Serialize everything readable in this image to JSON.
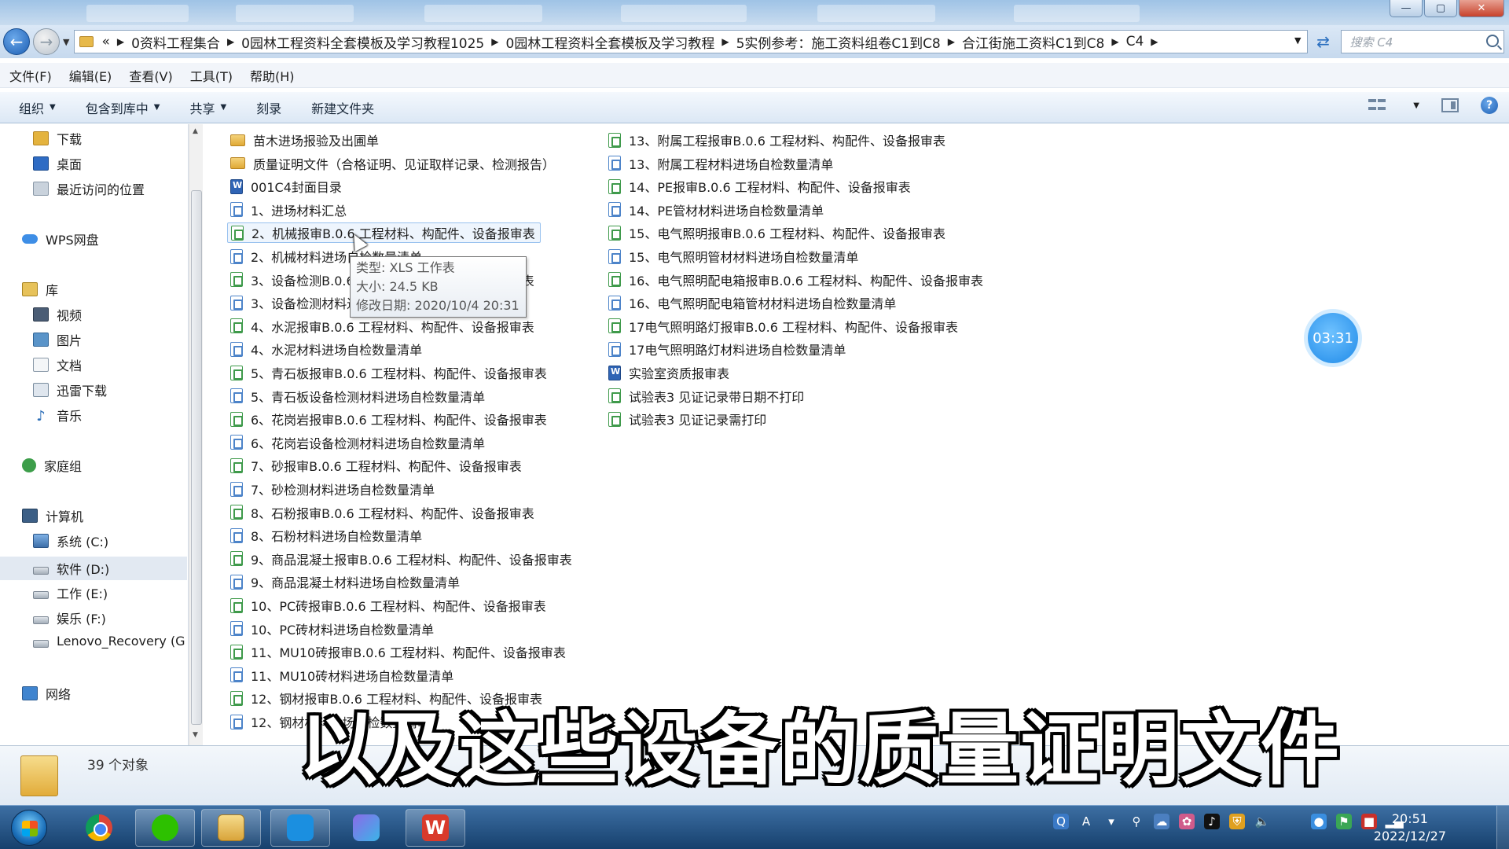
{
  "window_controls": {
    "minimize": "—",
    "maximize": "▢",
    "close": "✕"
  },
  "address": {
    "crumbs": [
      "«",
      "0资料工程集合",
      "0园林工程资料全套模板及学习教程1025",
      "0园林工程资料全套模板及学习教程",
      "5实例参考：施工资料组卷C1到C8",
      "合江街施工资料C1到C8",
      "C4"
    ],
    "search_placeholder": "搜索 C4"
  },
  "menu": [
    "文件(F)",
    "编辑(E)",
    "查看(V)",
    "工具(T)",
    "帮助(H)"
  ],
  "toolbar": {
    "organize": "组织",
    "include_library": "包含到库中",
    "share": "共享",
    "burn": "刻录",
    "new_folder": "新建文件夹"
  },
  "nav": {
    "downloads": "下载",
    "desktop": "桌面",
    "recent": "最近访问的位置",
    "wps_cloud": "WPS网盘",
    "libraries": "库",
    "videos": "视频",
    "pictures": "图片",
    "documents": "文档",
    "thunder": "迅雷下载",
    "music": "音乐",
    "homegroup": "家庭组",
    "computer": "计算机",
    "drive_c": "系统 (C:)",
    "drive_d": "软件 (D:)",
    "drive_e": "工作 (E:)",
    "drive_f": "娱乐 (F:)",
    "drive_g": "Lenovo_Recovery (G",
    "network": "网络"
  },
  "files_col1": [
    {
      "type": "folder",
      "name": "苗木进场报验及出圃单"
    },
    {
      "type": "folder",
      "name": "质量证明文件（合格证明、见证取样记录、检测报告）"
    },
    {
      "type": "doc",
      "name": "001C4封面目录"
    },
    {
      "type": "wps",
      "name": "1、进场材料汇总"
    },
    {
      "type": "xls",
      "name": "2、机械报审B.0.6 工程材料、构配件、设备报审表"
    },
    {
      "type": "wps",
      "name": "2、机械材料进场自检数量清单"
    },
    {
      "type": "xls",
      "name": "3、设备检测B.0.6 工程材料、构配件、设备报审表"
    },
    {
      "type": "wps",
      "name": "3、设备检测材料进场自检数量清单"
    },
    {
      "type": "xls",
      "name": "4、水泥报审B.0.6 工程材料、构配件、设备报审表"
    },
    {
      "type": "wps",
      "name": "4、水泥材料进场自检数量清单"
    },
    {
      "type": "xls",
      "name": "5、青石板报审B.0.6 工程材料、构配件、设备报审表"
    },
    {
      "type": "wps",
      "name": "5、青石板设备检测材料进场自检数量清单"
    },
    {
      "type": "xls",
      "name": "6、花岗岩报审B.0.6 工程材料、构配件、设备报审表"
    },
    {
      "type": "wps",
      "name": "6、花岗岩设备检测材料进场自检数量清单"
    },
    {
      "type": "xls",
      "name": "7、砂报审B.0.6 工程材料、构配件、设备报审表"
    },
    {
      "type": "wps",
      "name": "7、砂检测材料进场自检数量清单"
    },
    {
      "type": "xls",
      "name": "8、石粉报审B.0.6 工程材料、构配件、设备报审表"
    },
    {
      "type": "wps",
      "name": "8、石粉材料进场自检数量清单"
    },
    {
      "type": "xls",
      "name": "9、商品混凝土报审B.0.6 工程材料、构配件、设备报审表"
    },
    {
      "type": "wps",
      "name": "9、商品混凝土材料进场自检数量清单"
    },
    {
      "type": "xls",
      "name": "10、PC砖报审B.0.6 工程材料、构配件、设备报审表"
    },
    {
      "type": "wps",
      "name": "10、PC砖材料进场自检数量清单"
    },
    {
      "type": "xls",
      "name": "11、MU10砖报审B.0.6 工程材料、构配件、设备报审表"
    },
    {
      "type": "wps",
      "name": "11、MU10砖材料进场自检数量清单"
    },
    {
      "type": "xls",
      "name": "12、钢材报审B.0.6 工程材料、构配件、设备报审表"
    },
    {
      "type": "wps",
      "name": "12、钢材材料进场自检数量清单"
    }
  ],
  "files_col2": [
    {
      "type": "xls",
      "name": "13、附属工程报审B.0.6 工程材料、构配件、设备报审表"
    },
    {
      "type": "wps",
      "name": "13、附属工程材料进场自检数量清单"
    },
    {
      "type": "xls",
      "name": "14、PE报审B.0.6 工程材料、构配件、设备报审表"
    },
    {
      "type": "wps",
      "name": "14、PE管材材料进场自检数量清单"
    },
    {
      "type": "xls",
      "name": "15、电气照明报审B.0.6 工程材料、构配件、设备报审表"
    },
    {
      "type": "wps",
      "name": "15、电气照明管材材料进场自检数量清单"
    },
    {
      "type": "xls",
      "name": "16、电气照明配电箱报审B.0.6 工程材料、构配件、设备报审表"
    },
    {
      "type": "wps",
      "name": "16、电气照明配电箱管材材料进场自检数量清单"
    },
    {
      "type": "xls",
      "name": "17电气照明路灯报审B.0.6 工程材料、构配件、设备报审表"
    },
    {
      "type": "wps",
      "name": "17电气照明路灯材料进场自检数量清单"
    },
    {
      "type": "doc",
      "name": "实验室资质报审表"
    },
    {
      "type": "xls",
      "name": "试验表3 见证记录带日期不打印"
    },
    {
      "type": "xls",
      "name": "试验表3 见证记录需打印"
    }
  ],
  "tooltip": {
    "type": "类型: XLS 工作表",
    "size": "大小: 24.5 KB",
    "modified": "修改日期: 2020/10/4 20:31"
  },
  "timer": "03:31",
  "status": {
    "count": "39 个对象"
  },
  "subtitle": "以及这些设备的质量证明文件",
  "taskbar": {
    "wps": "W",
    "time": "20:51",
    "date": "2022/12/27"
  }
}
